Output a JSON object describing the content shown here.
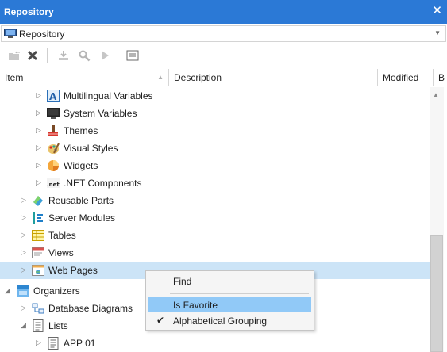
{
  "window": {
    "title": "Repository",
    "close_glyph": "✕"
  },
  "combo": {
    "value": "Repository",
    "icon": "repository-icon"
  },
  "toolbar": {
    "buttons": [
      {
        "name": "open-icon",
        "enabled": false
      },
      {
        "name": "delete-icon",
        "enabled": true
      },
      {
        "name": "import-icon",
        "enabled": false
      },
      {
        "name": "find-icon",
        "enabled": false
      },
      {
        "name": "run-icon",
        "enabled": false
      },
      {
        "name": "properties-icon",
        "enabled": true
      }
    ]
  },
  "columns": {
    "item": "Item",
    "description": "Description",
    "modified": "Modified",
    "b": "B"
  },
  "tree": {
    "rows": [
      {
        "label": "Multilingual Variables",
        "icon": "multilingual-variables-icon",
        "expanded": false
      },
      {
        "label": "System Variables",
        "icon": "system-variables-icon",
        "expanded": false
      },
      {
        "label": "Themes",
        "icon": "themes-icon",
        "expanded": false
      },
      {
        "label": "Visual Styles",
        "icon": "visual-styles-icon",
        "expanded": false
      },
      {
        "label": "Widgets",
        "icon": "widgets-icon",
        "expanded": false
      },
      {
        "label": ".NET Components",
        "icon": "dotnet-components-icon",
        "expanded": false
      },
      {
        "label": "Reusable Parts",
        "icon": "reusable-parts-icon",
        "expanded": false
      },
      {
        "label": "Server Modules",
        "icon": "server-modules-icon",
        "expanded": false
      },
      {
        "label": "Tables",
        "icon": "tables-icon",
        "expanded": false
      },
      {
        "label": "Views",
        "icon": "views-icon",
        "expanded": false
      },
      {
        "label": "Web Pages",
        "icon": "web-pages-icon",
        "expanded": false,
        "selected": true
      },
      {
        "label": "Organizers",
        "icon": "organizers-icon",
        "expanded": true
      },
      {
        "label": "Database Diagrams",
        "icon": "database-diagrams-icon",
        "expanded": false
      },
      {
        "label": "Lists",
        "icon": "lists-icon",
        "expanded": true
      },
      {
        "label": "APP 01",
        "icon": "list-item-icon",
        "expanded": false
      }
    ]
  },
  "context_menu": {
    "items": [
      {
        "label": "Find",
        "checked": false,
        "highlighted": false
      },
      {
        "label": "Is Favorite",
        "checked": false,
        "highlighted": true
      },
      {
        "label": "Alphabetical Grouping",
        "checked": true,
        "highlighted": false
      }
    ]
  },
  "colors": {
    "titlebar": "#2b79d6",
    "selection": "#cce4f7",
    "menu_highlight": "#91c9f7"
  }
}
